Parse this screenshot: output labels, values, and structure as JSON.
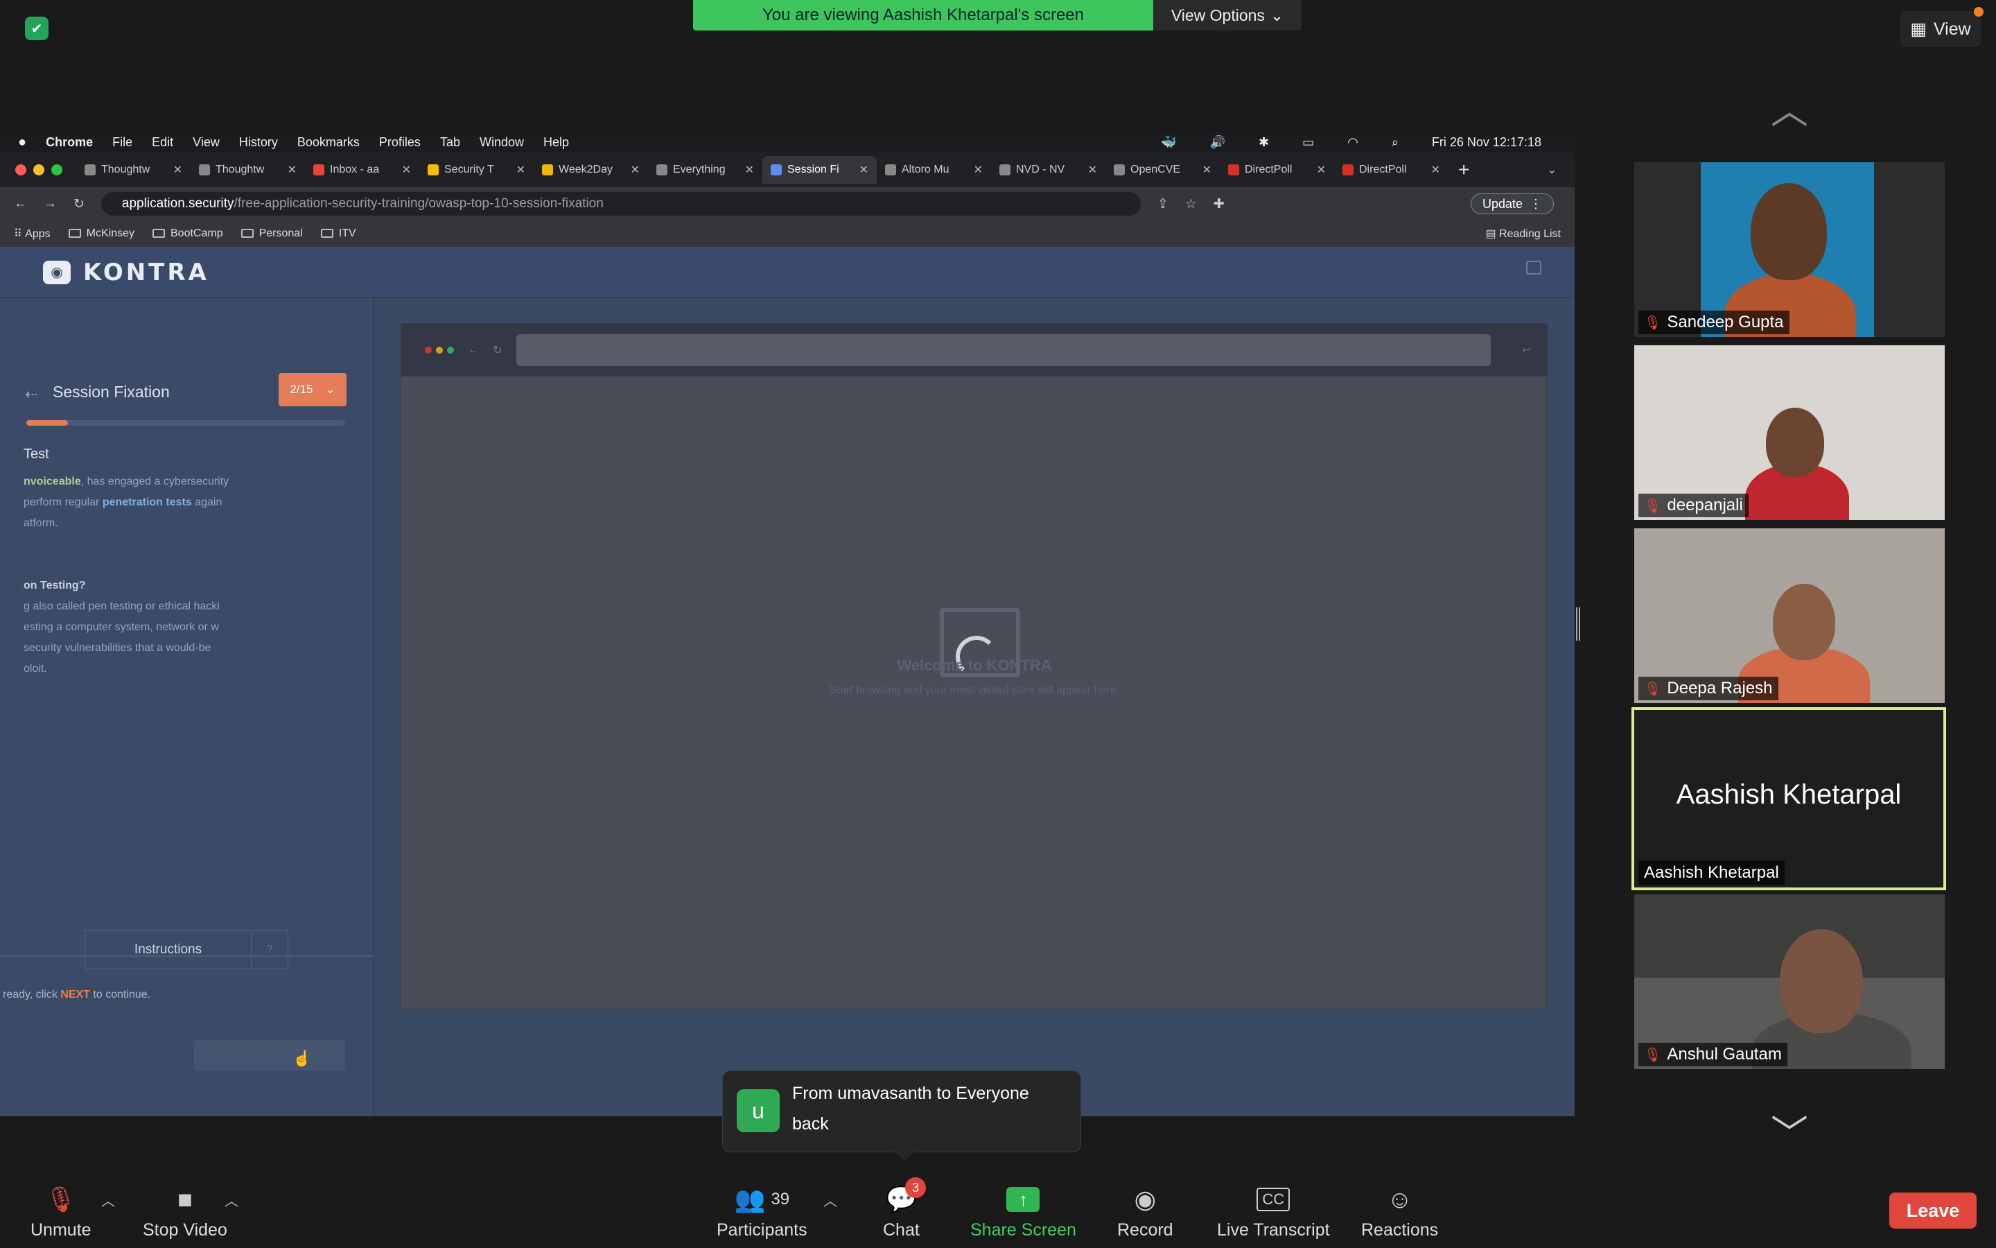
{
  "banner": {
    "text": "You are viewing Aashish Khetarpal's screen",
    "options": "View Options"
  },
  "view_button": "View",
  "mac_menu": {
    "app": "Chrome",
    "items": [
      "File",
      "Edit",
      "View",
      "History",
      "Bookmarks",
      "Profiles",
      "Tab",
      "Window",
      "Help"
    ],
    "clock": "Fri 26 Nov  12:17:18"
  },
  "tabs": [
    "Thoughtw",
    "Thoughtw",
    "Inbox - aa",
    "Security T",
    "Week2Day",
    "Everything",
    "Session Fi",
    "Altoro Mu",
    "NVD - NV",
    "OpenCVE",
    "DirectPoll",
    "DirectPoll"
  ],
  "address": {
    "host": "application.security",
    "path": "/free-application-security-training/owasp-top-10-session-fixation",
    "update": "Update"
  },
  "bookmarks": [
    "Apps",
    "McKinsey",
    "BootCamp",
    "Personal",
    "ITV"
  ],
  "reading_list": "Reading List",
  "kontra": {
    "logo": "KONTRA",
    "lesson_title": "Session Fixation",
    "step": "2/15",
    "section": "Test",
    "p1a": "nvoiceable",
    "p1b": ", has engaged a cybersecurity",
    "p2a": " perform regular ",
    "p2b": "penetration tests",
    "p2c": " again",
    "p3": "atform.",
    "q": "on Testing?",
    "d1": "g also called pen testing or ethical hacki",
    "d2": "esting a computer system, network or w",
    "d3": " security vulnerabilities that a would-be",
    "d4": "oloit.",
    "instructions": "Instructions",
    "hint_pre": "ready, click ",
    "hint_next": "NEXT",
    "hint_post": " to continue.",
    "welcome": "Welcome to KONTRA",
    "welcome_sub": "Start browsing and your most-visited sites will appear here."
  },
  "participants": [
    {
      "name": "Sandeep Gupta",
      "muted": true
    },
    {
      "name": "deepanjali",
      "muted": true
    },
    {
      "name": "Deepa Rajesh",
      "muted": true
    },
    {
      "name": "Aashish Khetarpal",
      "muted": false,
      "video": false
    },
    {
      "name": "Anshul Gautam",
      "muted": true
    }
  ],
  "chat_toast": {
    "avatar": "u",
    "from": "From umavasanth to Everyone",
    "message": "back"
  },
  "toolbar": {
    "unmute": "Unmute",
    "stop_video": "Stop Video",
    "participants": "Participants",
    "participant_count": "39",
    "chat": "Chat",
    "chat_badge": "3",
    "share": "Share Screen",
    "record": "Record",
    "live_transcript": "Live Transcript",
    "reactions": "Reactions",
    "leave": "Leave"
  },
  "colors": {
    "share_green": "#3dc65c",
    "leave_red": "#e0463c",
    "kontra_orange": "#e57c5a",
    "active_speaker": "#d5f08a"
  }
}
